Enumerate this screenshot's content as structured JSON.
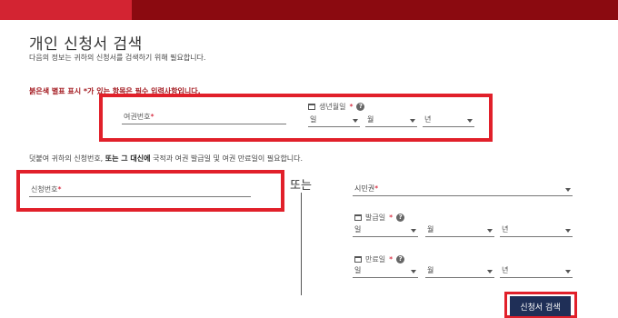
{
  "header": {
    "title": "개인 신청서 검색",
    "subtitle": "다음의 정보는 귀하의 신청서를 검색하기 위해 필요합니다."
  },
  "required_note": "붉은색 별표 표시 *가 있는 항목은 필수 입력사항입니다.",
  "section1": {
    "passport_label": "여권번호",
    "birth_label": "생년월일",
    "day": "일",
    "month": "월",
    "year": "년"
  },
  "middle_note": {
    "prefix": "덧붙여 귀하의 신청번호,",
    "emph": "또는 그 대신에",
    "suffix": "국적과 여권 발급일 및 여권 만료일이 필요합니다."
  },
  "section2": {
    "application_number_label": "신청번호",
    "or_text": "또는",
    "citizenship_label": "시민권",
    "issue_date_label": "발급일",
    "expiry_date_label": "만료일",
    "day": "일",
    "month": "월",
    "year": "년"
  },
  "required_mark": "*",
  "help_mark": "?",
  "search_button": "신청서 검색",
  "colors": {
    "accent_red": "#d32432",
    "dark_red": "#8b0a10",
    "highlight": "#e1202a",
    "button_navy": "#1f2f57"
  }
}
